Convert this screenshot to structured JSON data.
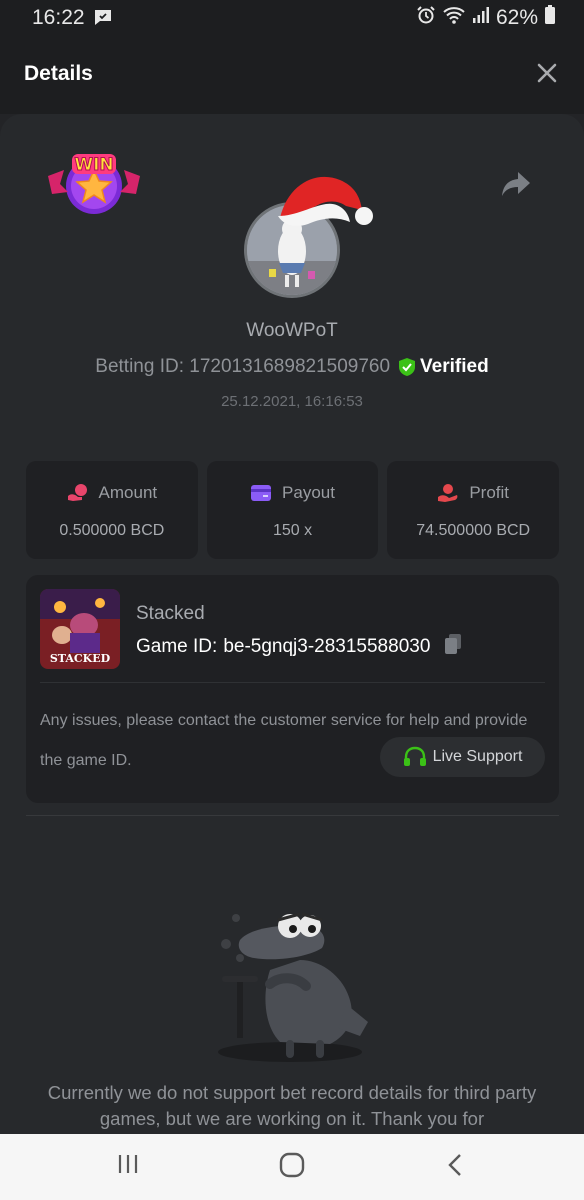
{
  "status_bar": {
    "time": "16:22",
    "battery": "62%"
  },
  "header": {
    "title": "Details"
  },
  "bet": {
    "username": "WooWPoT",
    "betting_id_label": "Betting ID: 1720131689821509760",
    "verified_label": "Verified",
    "datetime": "25.12.2021, 16:16:53",
    "badge_text": "WIN"
  },
  "stats": [
    {
      "label": "Amount",
      "value": "0.500000 BCD",
      "icon": "coins-icon",
      "color": "#e8456b"
    },
    {
      "label": "Payout",
      "value": "150 x",
      "icon": "card-icon",
      "color": "#8b5cf6"
    },
    {
      "label": "Profit",
      "value": "74.500000 BCD",
      "icon": "hand-coin-icon",
      "color": "#e5484d"
    }
  ],
  "game": {
    "name": "Stacked",
    "id_label": "Game ID:",
    "id_value": "be-5gnqj3-28315588030",
    "thumb_text": "STACKED",
    "issue_text": "Any issues, please contact the customer service for help and provide the game ID.",
    "live_support_label": "Live Support"
  },
  "notice": "Currently we do not support bet record details for third party games, but we are working on it. Thank you for",
  "colors": {
    "verified_green": "#3bc117",
    "support_green": "#3bc117",
    "background": "#232427"
  }
}
